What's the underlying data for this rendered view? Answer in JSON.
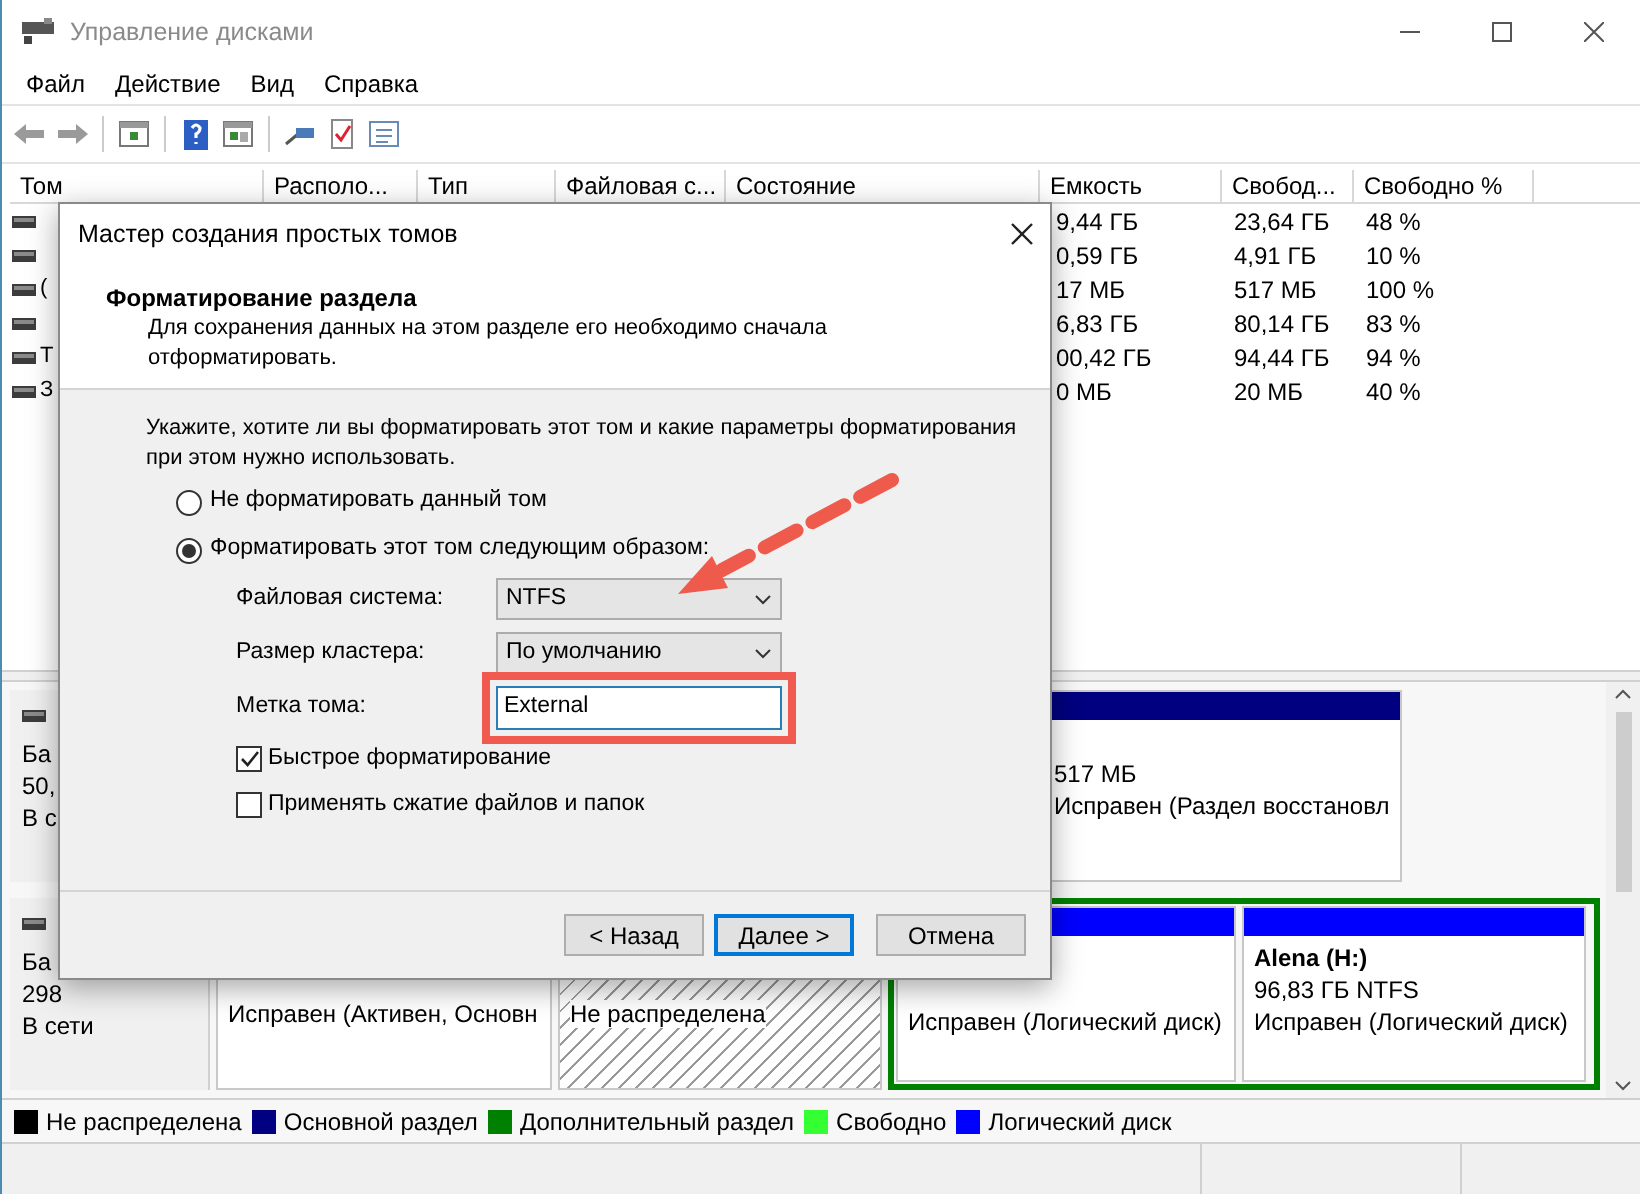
{
  "window": {
    "title": "Управление дисками"
  },
  "menu": [
    "Файл",
    "Действие",
    "Вид",
    "Справка"
  ],
  "table": {
    "columns": [
      "Том",
      "Располо...",
      "Тип",
      "Файловая с...",
      "Состояние",
      "Емкость",
      "Свобод...",
      "Свободно %"
    ],
    "rows": [
      {
        "capacity": "9,44 ГБ",
        "free": "23,64 ГБ",
        "free_percent": "48 %"
      },
      {
        "capacity": "0,59 ГБ",
        "free": "4,91 ГБ",
        "free_percent": "10 %"
      },
      {
        "volume": "(",
        "capacity": "17 МБ",
        "free": "517 МБ",
        "free_percent": "100 %"
      },
      {
        "capacity": "6,83 ГБ",
        "free": "80,14 ГБ",
        "free_percent": "83 %"
      },
      {
        "volume": "Т",
        "capacity": "00,42 ГБ",
        "free": "94,44 ГБ",
        "free_percent": "94 %"
      },
      {
        "volume": "З",
        "capacity": "0 МБ",
        "free": "20 МБ",
        "free_percent": "40 %"
      }
    ]
  },
  "disks": [
    {
      "label_lines": [
        "Ба",
        "50,",
        "В с"
      ],
      "partitions": [
        {
          "kind": "primary",
          "size": "517 МБ",
          "status": "Исправен (Раздел восстановл"
        }
      ]
    },
    {
      "label_lines": [
        "Ба",
        "298",
        "В сети"
      ],
      "partitions": [
        {
          "kind": "primary",
          "status": "Исправен (Активен, Основн"
        },
        {
          "kind": "unallocated",
          "status": "Не распределена"
        },
        {
          "kind": "extended",
          "children": [
            {
              "kind": "logical",
              "status": "Исправен (Логический диск)"
            },
            {
              "kind": "logical",
              "title": "Alena  (H:)",
              "size": "96,83 ГБ NTFS",
              "status": "Исправен (Логический диск)"
            }
          ]
        }
      ]
    }
  ],
  "legend": [
    {
      "label": "Не распределена",
      "color": "#000000"
    },
    {
      "label": "Основной раздел",
      "color": "#000080"
    },
    {
      "label": "Дополнительный раздел",
      "color": "#008000"
    },
    {
      "label": "Свободно",
      "color": "#33ff33"
    },
    {
      "label": "Логический диск",
      "color": "#0000ff"
    }
  ],
  "dialog": {
    "title": "Мастер создания простых томов",
    "heading": "Форматирование раздела",
    "description": "Для сохранения данных на этом разделе его необходимо сначала отформатировать.",
    "instruction": "Укажите, хотите ли вы форматировать этот том и какие параметры форматирования при этом нужно использовать.",
    "options": [
      {
        "label": "Не форматировать данный том",
        "selected": false
      },
      {
        "label": "Форматировать этот том следующим образом:",
        "selected": true
      }
    ],
    "fields": [
      {
        "kind": "select",
        "label": "Файловая система:",
        "value": "NTFS"
      },
      {
        "kind": "select",
        "label": "Размер кластера:",
        "value": "По умолчанию"
      },
      {
        "kind": "text",
        "label": "Метка тома:",
        "value": "External",
        "highlighted": true
      }
    ],
    "checkboxes": [
      {
        "label": "Быстрое форматирование",
        "checked": true
      },
      {
        "label": "Применять сжатие файлов и папок",
        "checked": false
      }
    ],
    "buttons": [
      {
        "label": "< Назад",
        "focused": false
      },
      {
        "label": "Далее >",
        "focused": true
      },
      {
        "label": "Отмена",
        "focused": false
      }
    ]
  }
}
